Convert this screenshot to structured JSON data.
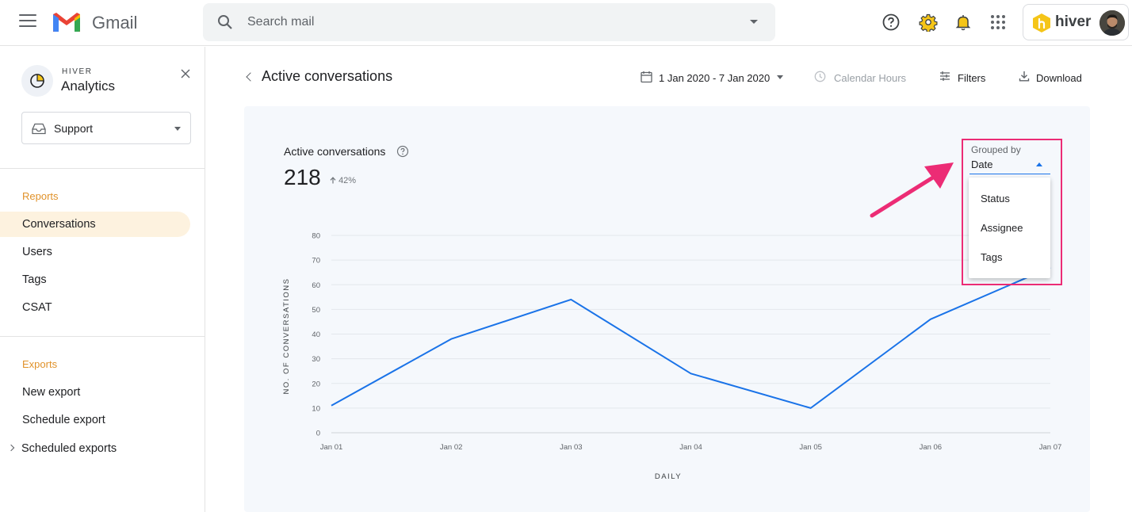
{
  "app": {
    "name": "Gmail",
    "search_placeholder": "Search mail",
    "addon_name": "hiver"
  },
  "sidebar": {
    "brand_small": "HIVER",
    "brand_big": "Analytics",
    "team_selector": "Support",
    "reports_header": "Reports",
    "reports": [
      "Conversations",
      "Users",
      "Tags",
      "CSAT"
    ],
    "active_report": "Conversations",
    "exports_header": "Exports",
    "exports": [
      "New export",
      "Schedule export",
      "Scheduled exports"
    ]
  },
  "main": {
    "title": "Active conversations",
    "date_range": "1 Jan 2020 - 7 Jan 2020",
    "hours": "Calendar Hours",
    "filters": "Filters",
    "download": "Download",
    "metric_label": "Active conversations",
    "metric_value": "218",
    "metric_delta": "42%"
  },
  "grouping": {
    "label": "Grouped by",
    "selected": "Date",
    "options": [
      "Status",
      "Assignee",
      "Tags"
    ]
  },
  "colors": {
    "line": "#1a73e8",
    "accent": "#e0922a",
    "highlight": "#ec2c75"
  },
  "chart_data": {
    "type": "line",
    "x": [
      "Jan 01",
      "Jan 02",
      "Jan 03",
      "Jan 04",
      "Jan 05",
      "Jan 06",
      "Jan 07"
    ],
    "series": [
      {
        "values": [
          11,
          38,
          54,
          24,
          10,
          46,
          67
        ]
      }
    ],
    "xlabel": "DAILY",
    "ylabel": "NO. OF CONVERSATIONS",
    "ylim": [
      0,
      80
    ],
    "yticks": [
      0,
      10,
      20,
      30,
      40,
      50,
      60,
      70,
      80
    ],
    "grid": true
  }
}
